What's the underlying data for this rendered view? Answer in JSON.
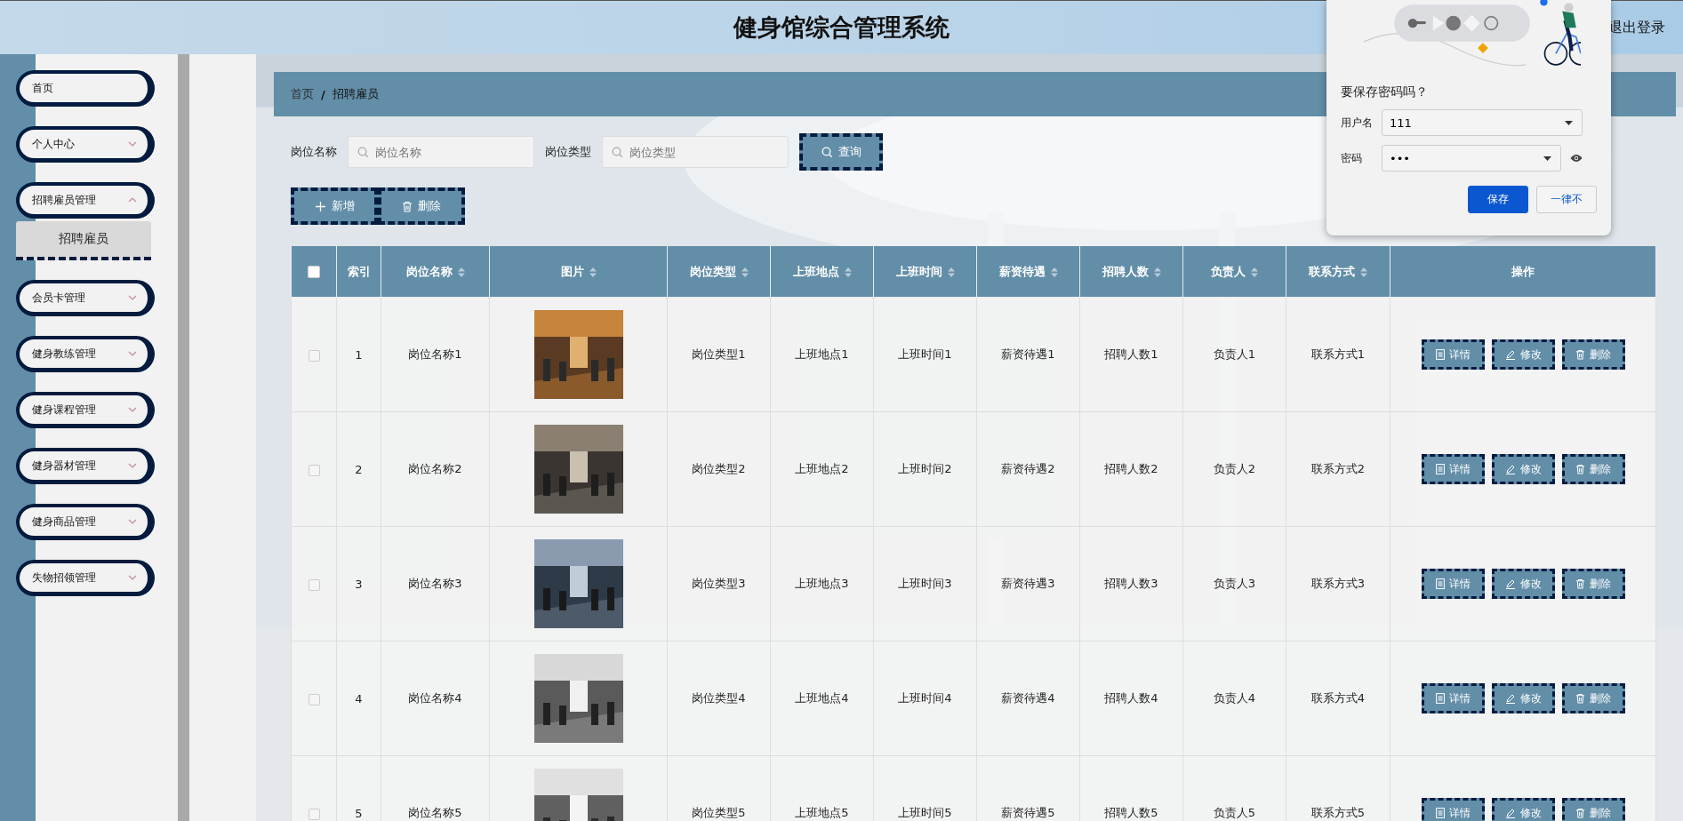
{
  "header": {
    "title": "健身馆综合管理系统",
    "logout": "退出登录"
  },
  "sidebar": {
    "items": [
      {
        "label": "首页",
        "kind": "link"
      },
      {
        "label": "个人中心",
        "kind": "submenu",
        "expanded": false
      },
      {
        "label": "招聘雇员管理",
        "kind": "submenu",
        "expanded": true,
        "children": [
          {
            "label": "招聘雇员",
            "selected": true
          }
        ]
      },
      {
        "label": "会员卡管理",
        "kind": "submenu",
        "expanded": false
      },
      {
        "label": "健身教练管理",
        "kind": "submenu",
        "expanded": false
      },
      {
        "label": "健身课程管理",
        "kind": "submenu",
        "expanded": false
      },
      {
        "label": "健身器材管理",
        "kind": "submenu",
        "expanded": false
      },
      {
        "label": "健身商品管理",
        "kind": "submenu",
        "expanded": false
      },
      {
        "label": "失物招领管理",
        "kind": "submenu",
        "expanded": false
      }
    ]
  },
  "breadcrumb": {
    "items": [
      "首页",
      "招聘雇员"
    ],
    "separator": "/"
  },
  "filters": [
    {
      "label": "岗位名称",
      "placeholder": "岗位名称"
    },
    {
      "label": "岗位类型",
      "placeholder": "岗位类型"
    }
  ],
  "search_button": "查询",
  "actions": [
    {
      "label": "新增",
      "kind": "add"
    },
    {
      "label": "删除",
      "kind": "delete"
    }
  ],
  "table": {
    "select_all": {
      "checked": false
    },
    "columns": [
      {
        "label": "索引",
        "sortable": false
      },
      {
        "label": "岗位名称",
        "sortable": true
      },
      {
        "label": "图片",
        "sortable": true
      },
      {
        "label": "岗位类型",
        "sortable": true
      },
      {
        "label": "上班地点",
        "sortable": true
      },
      {
        "label": "上班时间",
        "sortable": true
      },
      {
        "label": "薪资待遇",
        "sortable": true
      },
      {
        "label": "招聘人数",
        "sortable": true
      },
      {
        "label": "负责人",
        "sortable": true
      },
      {
        "label": "联系方式",
        "sortable": true
      },
      {
        "label": "操作",
        "sortable": false
      }
    ],
    "rows": [
      {
        "checked": false,
        "cells": [
          "1",
          "岗位名称1",
          {
            "kind": "picture"
          },
          "岗位类型1",
          "上班地点1",
          "上班时间1",
          "薪资待遇1",
          "招聘人数1",
          "负责人1",
          "联系方式1"
        ],
        "actions": [
          {
            "label": "详情",
            "kind": "detail"
          },
          {
            "label": "修改",
            "kind": "edit"
          },
          {
            "label": "删除",
            "kind": "delete"
          }
        ]
      },
      {
        "checked": false,
        "cells": [
          "2",
          "岗位名称2",
          {
            "kind": "picture"
          },
          "岗位类型2",
          "上班地点2",
          "上班时间2",
          "薪资待遇2",
          "招聘人数2",
          "负责人2",
          "联系方式2"
        ],
        "actions": [
          {
            "label": "详情",
            "kind": "detail"
          },
          {
            "label": "修改",
            "kind": "edit"
          },
          {
            "label": "删除",
            "kind": "delete"
          }
        ]
      },
      {
        "checked": false,
        "cells": [
          "3",
          "岗位名称3",
          {
            "kind": "picture"
          },
          "岗位类型3",
          "上班地点3",
          "上班时间3",
          "薪资待遇3",
          "招聘人数3",
          "负责人3",
          "联系方式3"
        ],
        "actions": [
          {
            "label": "详情",
            "kind": "detail"
          },
          {
            "label": "修改",
            "kind": "edit"
          },
          {
            "label": "删除",
            "kind": "delete"
          }
        ]
      },
      {
        "checked": false,
        "cells": [
          "4",
          "岗位名称4",
          {
            "kind": "picture"
          },
          "岗位类型4",
          "上班地点4",
          "上班时间4",
          "薪资待遇4",
          "招聘人数4",
          "负责人4",
          "联系方式4"
        ],
        "actions": [
          {
            "label": "详情",
            "kind": "detail"
          },
          {
            "label": "修改",
            "kind": "edit"
          },
          {
            "label": "删除",
            "kind": "delete"
          }
        ]
      },
      {
        "checked": false,
        "cells": [
          "5",
          "岗位名称5",
          {
            "kind": "picture"
          },
          "岗位类型5",
          "上班地点5",
          "上班时间5",
          "薪资待遇5",
          "招聘人数5",
          "负责人5",
          "联系方式5"
        ],
        "actions": [
          {
            "label": "详情",
            "kind": "detail"
          },
          {
            "label": "修改",
            "kind": "edit"
          },
          {
            "label": "删除",
            "kind": "delete"
          }
        ]
      }
    ]
  },
  "password_popup": {
    "title": "要保存密码吗？",
    "fields": [
      {
        "label": "用户名",
        "value": "111",
        "kind": "text"
      },
      {
        "label": "密码",
        "value": "•••",
        "kind": "password"
      }
    ],
    "buttons": [
      {
        "label": "保存",
        "primary": true
      },
      {
        "label": "一律不",
        "primary": false
      }
    ]
  }
}
